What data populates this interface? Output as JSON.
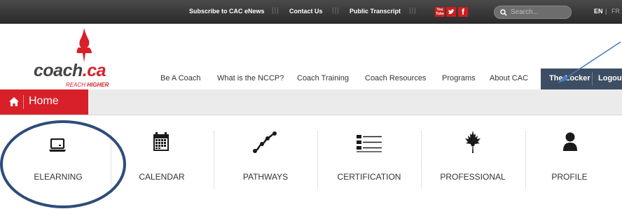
{
  "topbar": {
    "subscribe": "Subscribe to CAC eNews",
    "separator": "|||",
    "contact": "Contact Us",
    "transcript": "Public Transcript",
    "social": {
      "youtube_line1": "You",
      "youtube_line2": "Tube",
      "facebook": "f"
    },
    "search_placeholder": "Search...",
    "lang_en": "EN",
    "lang_sep": "|",
    "lang_fr": "FR"
  },
  "logo": {
    "word_left": "coach",
    "word_right": ".ca",
    "tagline_light": "REACH",
    "tagline_bold": "HIGHER"
  },
  "nav": {
    "items": [
      {
        "label": "Be A Coach"
      },
      {
        "label": "What is the NCCP?"
      },
      {
        "label": "Coach Training"
      },
      {
        "label": "Coach Resources"
      },
      {
        "label": "Programs"
      },
      {
        "label": "About CAC"
      }
    ],
    "locker": "The Locker",
    "logout": "Logout"
  },
  "breadcrumb": {
    "home": "Home"
  },
  "tiles": [
    {
      "label": "ELEARNING",
      "icon": "laptop-icon"
    },
    {
      "label": "CALENDAR",
      "icon": "calendar-icon"
    },
    {
      "label": "PATHWAYS",
      "icon": "pathway-icon"
    },
    {
      "label": "CERTIFICATION",
      "icon": "certification-icon"
    },
    {
      "label": "PROFESSIONAL",
      "icon": "maple-leaf-icon"
    },
    {
      "label": "PROFILE",
      "icon": "person-icon"
    }
  ],
  "colors": {
    "brand_red": "#d8202a",
    "locker_bg": "#3d4d63",
    "annotation": "#2e4c7a"
  }
}
